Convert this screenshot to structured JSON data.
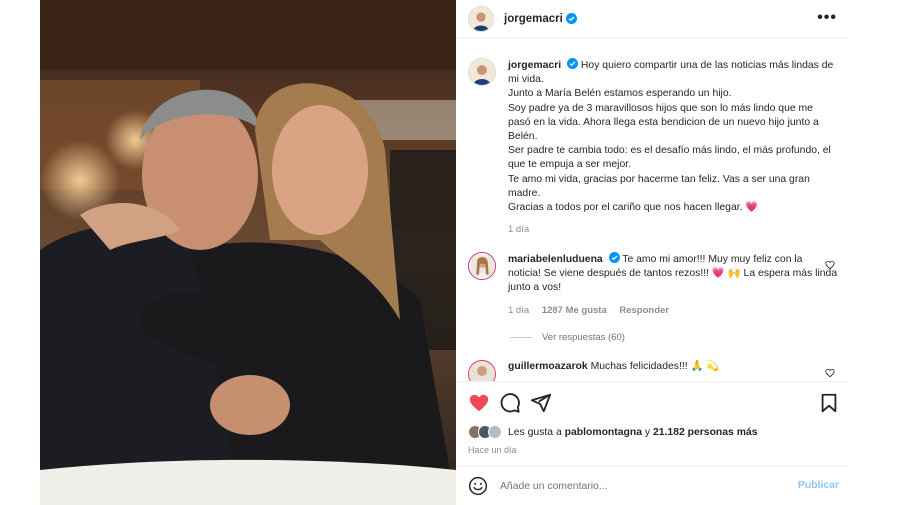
{
  "post": {
    "username": "jorgemacri",
    "more_label": "•••"
  },
  "caption": {
    "username": "jorgemacri",
    "paragraphs": [
      "Hoy quiero compartir una de las noticias más lindas de mi vida.",
      "Junto a María Belén estamos esperando un hijo.",
      "Soy padre ya de 3 maravillosos hijos que son lo más lindo que me pasó en la vida. Ahora llega esta bendicion de un nuevo hijo junto a Belén.",
      "Ser padre te cambia todo: es el desafío más lindo, el más profundo, el que te empuja a ser mejor.",
      "Te amo mi vida, gracias por hacerme tan feliz. Vas a ser una gran madre.",
      "Gracias a todos por el cariño que nos hacen llegar. 💗"
    ],
    "time": "1 día"
  },
  "comment1": {
    "username": "mariabelenluduena",
    "text": "Te amo mi amor!!! Muy muy feliz con la noticia! Se viene después de tantos rezos!!! 💗 🙌 La espera más linda junto a vos!",
    "time": "1 día",
    "likes": "1287 Me gusta",
    "reply": "Responder",
    "view_replies": "Ver respuestas (60)"
  },
  "comment2": {
    "username": "guillermoazarok",
    "text": "Muchas felicidades!!! 🙏 💫"
  },
  "likes": {
    "prefix": "Les gusta a",
    "user": "pablomontagna",
    "joiner": "y",
    "others": "21.182 personas más",
    "time": "Hace un día"
  },
  "add_comment": {
    "placeholder": "Añade un comentario...",
    "publish": "Publicar"
  },
  "colors": {
    "like_red": "#ed4956",
    "verified_blue": "#0095f6",
    "publish_disabled": "#8dc6f4"
  },
  "icons": [
    "heart-icon",
    "comment-icon",
    "share-icon",
    "bookmark-icon",
    "emoji-icon",
    "verified-icon",
    "more-icon"
  ]
}
